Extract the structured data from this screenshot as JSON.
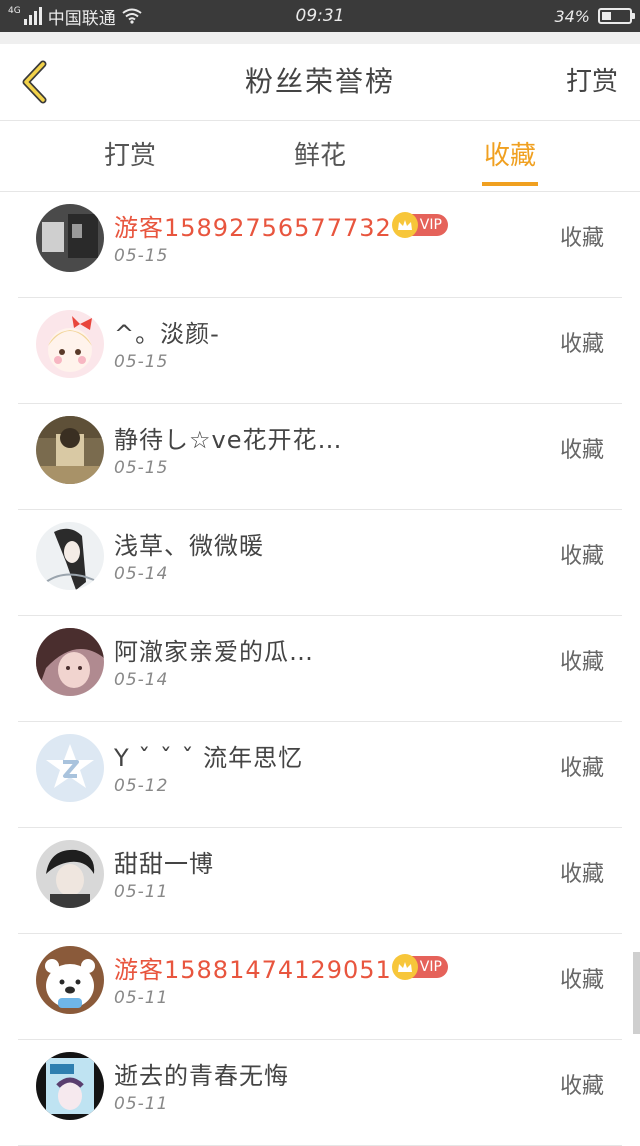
{
  "status_bar": {
    "network_label": "4G",
    "carrier": "中国联通",
    "time": "09:31",
    "battery_percent_text": "34%",
    "battery_level": 0.34
  },
  "nav": {
    "title": "粉丝荣誉榜",
    "right_action": "打赏"
  },
  "tabs": [
    {
      "label": "打赏",
      "active": false
    },
    {
      "label": "鲜花",
      "active": false
    },
    {
      "label": "收藏",
      "active": true
    }
  ],
  "colors": {
    "accent": "#f0a020",
    "guest_name": "#e8553e",
    "vip_badge": "#e5625a"
  },
  "rows": [
    {
      "name": "游客15892756577732",
      "guest": true,
      "vip": "VIP",
      "date": "05-15",
      "action": "收藏",
      "avatar": "dark-photo"
    },
    {
      "name": "^。淡颜-",
      "guest": false,
      "vip": "",
      "date": "05-15",
      "action": "收藏",
      "avatar": "cartoon-girl"
    },
    {
      "name": "静待し☆ve花开花…",
      "guest": false,
      "vip": "",
      "date": "05-15",
      "action": "收藏",
      "avatar": "beige-photo"
    },
    {
      "name": "浅草、微微暖",
      "guest": false,
      "vip": "",
      "date": "05-14",
      "action": "收藏",
      "avatar": "ink-girl"
    },
    {
      "name": "阿澈家亲爱的瓜…",
      "guest": false,
      "vip": "",
      "date": "05-14",
      "action": "收藏",
      "avatar": "pink-photo"
    },
    {
      "name": "Y ˇ ˇ ˇ 流年思忆",
      "guest": false,
      "vip": "",
      "date": "05-12",
      "action": "收藏",
      "avatar": "default-qq"
    },
    {
      "name": "甜甜一博",
      "guest": false,
      "vip": "",
      "date": "05-11",
      "action": "收藏",
      "avatar": "boy-photo"
    },
    {
      "name": "游客15881474129051",
      "guest": true,
      "vip": "VIP",
      "date": "05-11",
      "action": "收藏",
      "avatar": "bear"
    },
    {
      "name": "逝去的青春无悔",
      "guest": false,
      "vip": "",
      "date": "05-11",
      "action": "收藏",
      "avatar": "anime"
    }
  ]
}
